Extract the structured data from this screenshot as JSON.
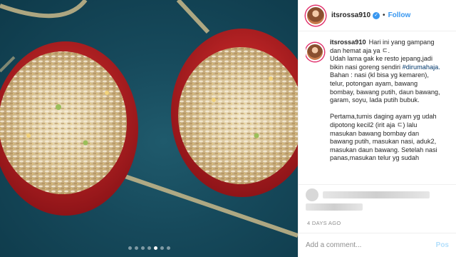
{
  "post": {
    "username": "itsrossa910",
    "verified_glyph": "✓",
    "separator": "•",
    "follow_label": "Follow",
    "caption": {
      "lines": [
        "Hari ini yang gampang",
        "dan hemat aja ya ㄷ.",
        "Udah lama gak ke resto jepang,jadi",
        "bikin nasi goreng sendiri",
        "Bahan : nasi (kl bisa yg kemaren),",
        "telur, potongan ayam, bawang",
        "bombay, bawang putih, daun bawang,",
        "garam, soyu, lada putih bubuk.",
        "Pertama,tumis daging ayam yg udah",
        "dipotong kecil2 (irit aja ㄷ) lalu",
        "masukan bawang bombay dan",
        "bawang putih, masukan nasi, aduk2,",
        "masukan daun bawang. Setelah nasi",
        "panas,masukan telur yg sudah"
      ],
      "hashtag": "#dirumahaja."
    },
    "time_label": "4 DAYS AGO",
    "comment_placeholder": "Add a comment...",
    "post_button": "Pos"
  },
  "carousel": {
    "total": 7,
    "active": 4
  },
  "icons": {
    "avatar": "profile-avatar-icon",
    "verified": "verified-badge-icon"
  },
  "colors": {
    "accent": "#3897f0",
    "story_ring": "#e1306c",
    "bowl_red": "#c8202a",
    "backdrop": "#16495b"
  }
}
